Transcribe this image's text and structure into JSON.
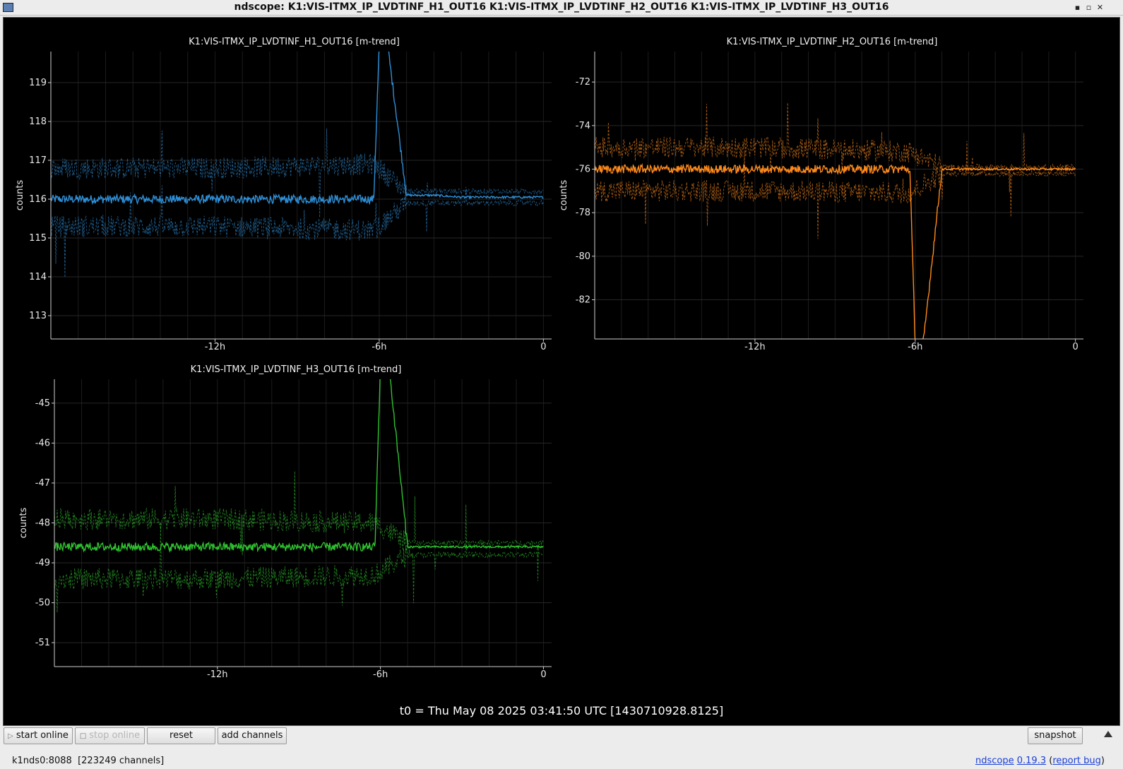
{
  "window": {
    "title": "ndscope: K1:VIS-ITMX_IP_LVDTINF_H1_OUT16 K1:VIS-ITMX_IP_LVDTINF_H2_OUT16 K1:VIS-ITMX_IP_LVDTINF_H3_OUT16",
    "minimize_label": "▪",
    "maximize_label": "▫",
    "close_label": "✕"
  },
  "t0_label": "t0 = Thu May 08 2025 03:41:50 UTC [1430710928.8125]",
  "toolbar": {
    "start_online": "start online",
    "stop_online": "stop online",
    "reset": "reset",
    "add_channels": "add channels",
    "snapshot": "snapshot"
  },
  "status": {
    "server": "k1nds0:8088",
    "channels": "[223249 channels]",
    "app_link": "ndscope",
    "version_link": "0.19.3",
    "report_link": "report bug"
  },
  "colors": {
    "h1": "#2e8fd8",
    "h2": "#ff8a1a",
    "h3": "#2fc22f"
  },
  "chart_data": [
    {
      "type": "line",
      "title": "K1:VIS-ITMX_IP_LVDTINF_H1_OUT16 [m-trend]",
      "ylabel": "counts",
      "xlabel": "",
      "color": "#2e8fd8",
      "x_ticks": [
        -12,
        -6,
        0
      ],
      "x_tick_labels": [
        "-12h",
        "-6h",
        "0"
      ],
      "xlim": [
        -18,
        0.3
      ],
      "y_ticks": [
        113,
        114,
        115,
        116,
        117,
        118,
        119
      ],
      "ylim": [
        112.4,
        119.8
      ],
      "grid": true,
      "series": [
        {
          "x": [
            -18,
            -12,
            -6.2,
            -6.0,
            -5.7,
            -5.0,
            -4.0,
            -3.0,
            0
          ],
          "y": [
            116.0,
            116.0,
            116.0,
            120,
            120,
            116.1,
            116.1,
            116.05,
            116.05
          ]
        },
        {
          "x": [
            -18,
            -12,
            -6.2,
            -5.0,
            0
          ],
          "y": [
            116.8,
            116.8,
            116.9,
            116.2,
            116.2
          ]
        },
        {
          "x": [
            -18,
            -12,
            -6.2,
            -5.0,
            0
          ],
          "y": [
            115.3,
            115.3,
            115.2,
            115.9,
            115.9
          ]
        }
      ]
    },
    {
      "type": "line",
      "title": "K1:VIS-ITMX_IP_LVDTINF_H2_OUT16 [m-trend]",
      "ylabel": "counts",
      "xlabel": "",
      "color": "#ff8a1a",
      "x_ticks": [
        -12,
        -6,
        0
      ],
      "x_tick_labels": [
        "-12h",
        "-6h",
        "0"
      ],
      "xlim": [
        -18,
        0.3
      ],
      "y_ticks": [
        -72,
        -74,
        -76,
        -78,
        -80,
        -82
      ],
      "ylim": [
        -83.8,
        -70.6
      ],
      "grid": true,
      "series": [
        {
          "x": [
            -18,
            -12,
            -6.2,
            -6.0,
            -5.7,
            -5.0,
            -4.0,
            0
          ],
          "y": [
            -76.0,
            -76.0,
            -76.0,
            -84,
            -84,
            -76.0,
            -76.0,
            -76.0
          ]
        },
        {
          "x": [
            -18,
            -12,
            -6.2,
            -5.0,
            0
          ],
          "y": [
            -75.0,
            -75.0,
            -75.2,
            -75.9,
            -75.9
          ]
        },
        {
          "x": [
            -18,
            -12,
            -6.2,
            -5.0,
            0
          ],
          "y": [
            -77.0,
            -77.0,
            -77.1,
            -76.2,
            -76.2
          ]
        }
      ]
    },
    {
      "type": "line",
      "title": "K1:VIS-ITMX_IP_LVDTINF_H3_OUT16 [m-trend]",
      "ylabel": "counts",
      "xlabel": "",
      "color": "#2fc22f",
      "x_ticks": [
        -12,
        -6,
        0
      ],
      "x_tick_labels": [
        "-12h",
        "-6h",
        "0"
      ],
      "xlim": [
        -18,
        0.3
      ],
      "y_ticks": [
        -45,
        -46,
        -47,
        -48,
        -49,
        -50,
        -51
      ],
      "ylim": [
        -51.6,
        -44.4
      ],
      "grid": true,
      "series": [
        {
          "x": [
            -18,
            -12,
            -6.2,
            -6.0,
            -5.7,
            -5.0,
            -4.0,
            0
          ],
          "y": [
            -48.6,
            -48.6,
            -48.6,
            -44,
            -44,
            -48.6,
            -48.6,
            -48.6
          ]
        },
        {
          "x": [
            -18,
            -12,
            -6.2,
            -5.0,
            0
          ],
          "y": [
            -47.9,
            -47.9,
            -48.0,
            -48.5,
            -48.5
          ]
        },
        {
          "x": [
            -18,
            -12,
            -6.2,
            -5.0,
            0
          ],
          "y": [
            -49.4,
            -49.4,
            -49.3,
            -48.8,
            -48.8
          ]
        }
      ]
    }
  ]
}
